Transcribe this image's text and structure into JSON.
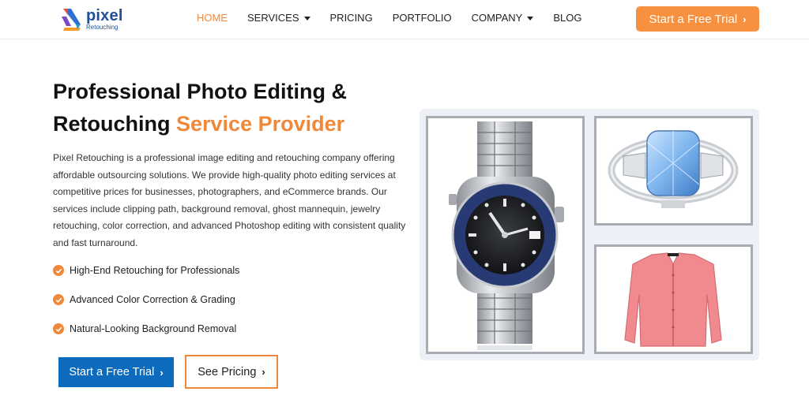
{
  "brand": {
    "name": "pixel",
    "tagline": "Retouching"
  },
  "nav": {
    "items": [
      {
        "label": "HOME",
        "active": true,
        "dropdown": false
      },
      {
        "label": "SERVICES",
        "active": false,
        "dropdown": true
      },
      {
        "label": "PRICING",
        "active": false,
        "dropdown": false
      },
      {
        "label": "PORTFOLIO",
        "active": false,
        "dropdown": false
      },
      {
        "label": "COMPANY",
        "active": false,
        "dropdown": true
      },
      {
        "label": "BLOG",
        "active": false,
        "dropdown": false
      }
    ],
    "cta_label": "Start a Free Trial"
  },
  "hero": {
    "title_line1": "Professional Photo Editing &",
    "title_line2_plain": "Retouching ",
    "title_line2_accent": "Service Provider",
    "description": "Pixel Retouching is a professional image editing and retouching company offering affordable outsourcing solutions. We provide high-quality photo editing services at competitive prices for businesses, photographers, and eCommerce brands. Our services include clipping path, background removal, ghost mannequin, jewelry retouching, color correction, and advanced Photoshop editing with consistent quality and fast turnaround.",
    "features": [
      "High-End Retouching for Professionals",
      "Advanced Color Correction & Grading",
      "Natural-Looking Background Removal"
    ],
    "primary_cta": "Start a Free Trial",
    "secondary_cta": "See Pricing"
  },
  "collage": {
    "images": [
      "wristwatch",
      "ring",
      "cardigan"
    ]
  },
  "colors": {
    "accent_orange": "#f0883a",
    "brand_blue": "#0d6bbd",
    "logo_blue": "#1d4f9c"
  }
}
